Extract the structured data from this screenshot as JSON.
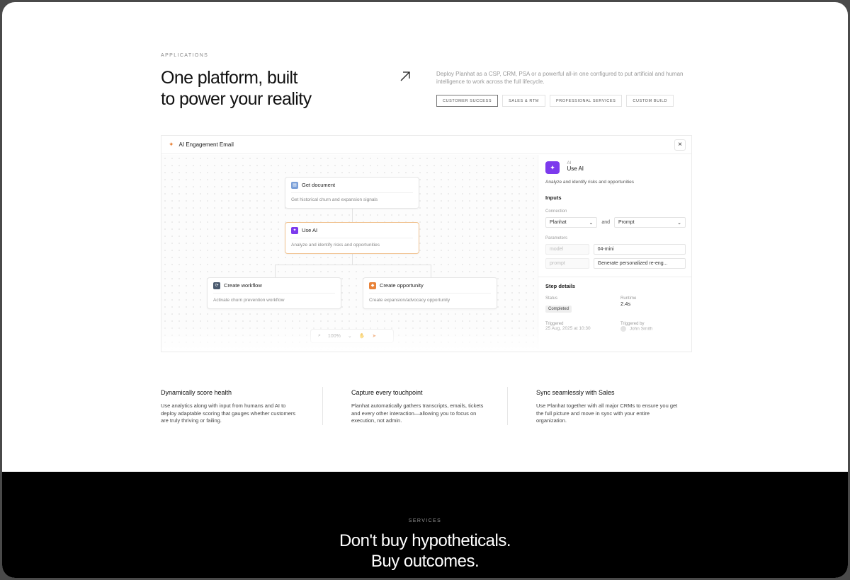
{
  "section": {
    "eyebrow": "APPLICATIONS",
    "headline_line1": "One platform, built",
    "headline_line2": "to power your reality",
    "intro": "Deploy Planhat as a CSP, CRM, PSA or a powerful all-in one configured to put artificial and human intelligence to work across the full lifecycle.",
    "pills": [
      "CUSTOMER SUCCESS",
      "SALES & RTM",
      "PROFESSIONAL SERVICES",
      "CUSTOM BUILD"
    ]
  },
  "panel": {
    "title": "AI Engagement Email",
    "close_icon": "×",
    "nodes": {
      "get_document": {
        "title": "Get document",
        "desc": "Get historical churn and expansion signals"
      },
      "use_ai": {
        "title": "Use AI",
        "desc": "Analyze and identify risks and opportunities"
      },
      "create_workflow": {
        "title": "Create workflow",
        "desc": "Activate churn prevention workflow"
      },
      "create_opportunity": {
        "title": "Create opportunity",
        "desc": "Create expansion/advocacy opportunity"
      }
    },
    "toolbar": {
      "zoom": "100%"
    },
    "side": {
      "kicker": "AI",
      "title": "Use AI",
      "desc": "Analyze and identify risks and opportunities",
      "inputs_heading": "Inputs",
      "connection_label": "Connection",
      "connection_value": "Planhat",
      "and_label": "and",
      "prompt_select": "Prompt",
      "parameters_label": "Parameters",
      "params": [
        {
          "key": "model",
          "value": "04-mini"
        },
        {
          "key": "prompt",
          "value": "Generate personalized re-eng..."
        }
      ],
      "step_details_heading": "Step details",
      "status_label": "Status",
      "status_value": "Completed",
      "runtime_label": "Runtime",
      "runtime_value": "2.4s",
      "triggered_label": "Triggered",
      "triggered_value": "25 Aug, 2025 at 10:30",
      "triggered_by_label": "Triggered by",
      "triggered_by_value": "John Smith"
    }
  },
  "features": [
    {
      "title": "Dynamically score health",
      "body": "Use analytics along with input from humans and AI to deploy adaptable scoring that gauges whether customers are truly thriving or failing."
    },
    {
      "title": "Capture every touchpoint",
      "body": "Planhat automatically gathers transcripts, emails, tickets and every other interaction—allowing you to focus on execution, not admin."
    },
    {
      "title": "Sync seamlessly with Sales",
      "body": "Use Planhat together with all major CRMs to ensure you get the full picture and move in sync with your entire organization."
    }
  ],
  "services": {
    "eyebrow": "SERVICES",
    "headline_line1": "Don't buy hypotheticals.",
    "headline_line2": "Buy outcomes."
  },
  "colors": {
    "accent_ai": "#7c3aed",
    "accent_orange": "#e8833a",
    "dark_bg": "#000000"
  }
}
